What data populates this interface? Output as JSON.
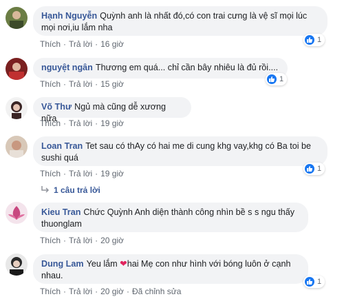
{
  "labels": {
    "like": "Thích",
    "reply": "Trả lời",
    "dot": "·"
  },
  "comments": [
    {
      "author": "Hạnh Nguyễn",
      "text": "Quỳnh anh là nhất đó,có con trai cưng là vệ sĩ mọi lúc mọi nơi,iu lắm nha",
      "time": "16 giờ",
      "likes": "1",
      "avatar_color": "#5a6a3a"
    },
    {
      "author": "nguyệt ngân",
      "text": "Thương em quá... chỉ cần bây nhiêu là đủ rồi....",
      "time": "15 giờ",
      "likes": "1",
      "avatar_color": "#8a2a2a"
    },
    {
      "author": "Võ Thư",
      "text": "Ngủ mà cũng dễ xương nữa",
      "time": "19 giờ",
      "avatar_color": "#3a2a2a"
    },
    {
      "author": "Loan Tran",
      "text": "Tet sau có thAy có hai me di cung khg vay,khg có Ba toi be sushi quá",
      "time": "19 giờ",
      "likes": "1",
      "avatar_color": "#c8a080",
      "replies_label": "1 câu trả lời"
    },
    {
      "author": "Kieu Tran",
      "text": "Chức Quỳnh Anh diện thành công nhìn bề s s ngu thấy thuonglam",
      "time": "20 giờ",
      "avatar_color": "#c05080"
    },
    {
      "author": "Dung Lam",
      "text_before": "Yeu lắm",
      "emoji": "❤",
      "text_after": "hai Mẹ con như hình với bóng luôn ở cạnh nhau.",
      "time": "20 giờ",
      "likes": "1",
      "edited": "Đã chỉnh sửa",
      "avatar_color": "#2a2a2a"
    }
  ]
}
